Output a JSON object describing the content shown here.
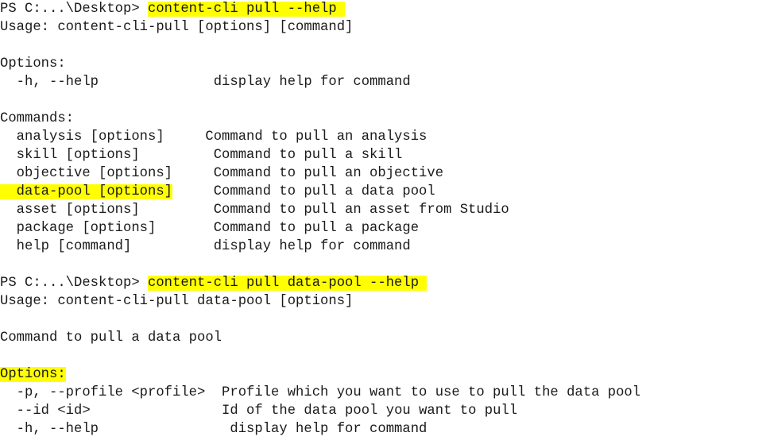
{
  "terminal": {
    "shell": "PowerShell",
    "colors": {
      "background": "#ffffff",
      "text": "#1a1a1a",
      "highlight": "#ffff00"
    },
    "prompt_text": "PS C:...\\Desktop> ",
    "blocks": [
      {
        "id": "first-invocation",
        "prompt": "PS C:...\\Desktop> ",
        "command": "content-cli pull --help",
        "usage": "Usage: content-cli-pull [options] [command]",
        "options_heading": "Options:",
        "options": [
          {
            "flags": "  -h, --help",
            "description": "display help for command"
          }
        ],
        "commands_heading": "Commands:",
        "commands": [
          {
            "name": "  analysis [options]",
            "description": "Command to pull an analysis",
            "highlighted": false
          },
          {
            "name": "  skill [options]",
            "description": "Command to pull a skill",
            "highlighted": false
          },
          {
            "name": "  objective [options]",
            "description": "Command to pull an objective",
            "highlighted": false
          },
          {
            "name": "  data-pool [options]",
            "description": "Command to pull a data pool",
            "highlighted": true
          },
          {
            "name": "  asset [options]",
            "description": "Command to pull an asset from Studio",
            "highlighted": false
          },
          {
            "name": "  package [options]",
            "description": "Command to pull a package",
            "highlighted": false
          },
          {
            "name": "  help [command]",
            "description": "display help for command",
            "highlighted": false
          }
        ]
      },
      {
        "id": "second-invocation",
        "prompt": "PS C:...\\Desktop> ",
        "command": "content-cli pull data-pool --help",
        "usage": "Usage: content-cli-pull data-pool [options]",
        "summary": "Command to pull a data pool",
        "options_heading": "Options:",
        "options_heading_highlighted": true,
        "options": [
          {
            "flags": "  -p, --profile <profile>",
            "description": "Profile which you want to use to pull the data pool"
          },
          {
            "flags": "  --id <id>",
            "description": "Id of the data pool you want to pull"
          },
          {
            "flags": "  -h, --help",
            "description": "display help for command"
          }
        ]
      }
    ]
  }
}
